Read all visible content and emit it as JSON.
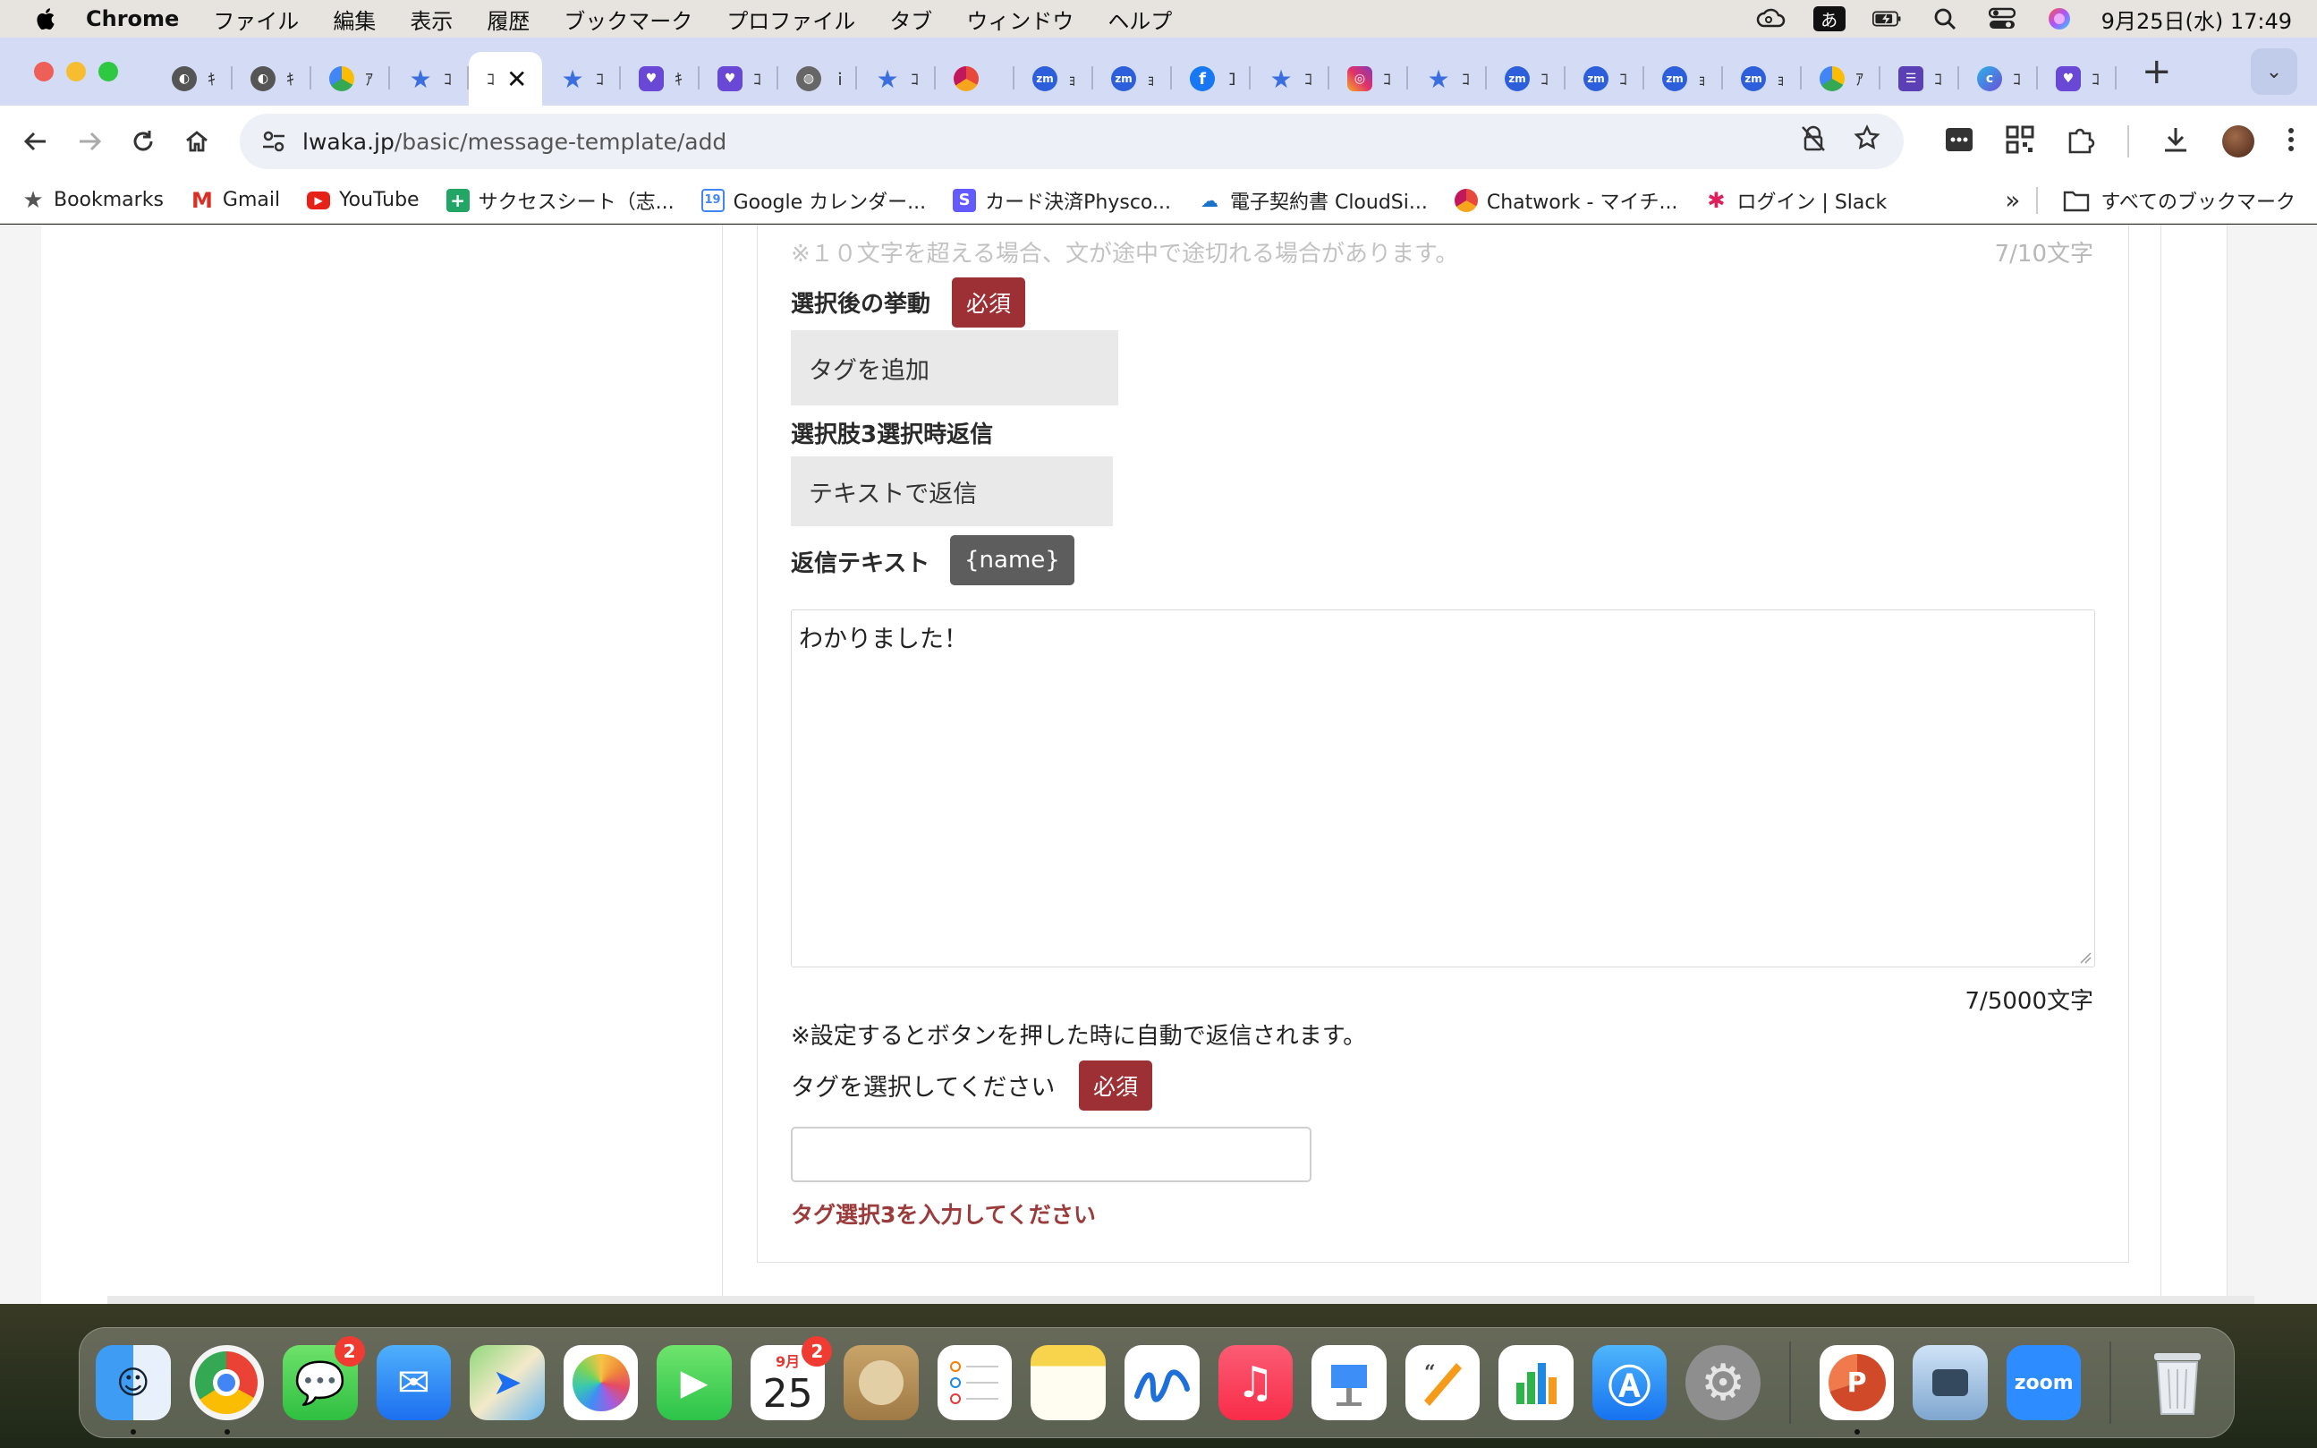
{
  "menubar": {
    "app_name": "Chrome",
    "items": [
      "ファイル",
      "編集",
      "表示",
      "履歴",
      "ブックマーク",
      "プロファイル",
      "タブ",
      "ウィンドウ",
      "ヘルプ"
    ],
    "ime": "あ",
    "clock": "9月25日(水)  17:49"
  },
  "tabs": {
    "active_title": "ｺ",
    "titles": [
      "ｷ",
      "ｷ",
      "ｱ",
      "ｺ",
      "ｺ",
      "ｷ",
      "ｺ",
      "ｉ",
      "ｺ",
      "（",
      "ｮ",
      "ｮ",
      "Ｉ",
      "ｺ",
      "ｺ",
      "ｺ",
      "ｺ",
      "ｺ",
      "ｮ",
      "ｮ",
      "ｱ",
      "ｺ",
      "ｺ",
      "ｺ"
    ]
  },
  "toolbar": {
    "url_domain": "lwaka.jp",
    "url_path": "/basic/message-template/add"
  },
  "bookmarks": {
    "items": [
      {
        "label": "Bookmarks",
        "icon": "star-icon"
      },
      {
        "label": "Gmail",
        "icon": "gmail-icon"
      },
      {
        "label": "YouTube",
        "icon": "youtube-icon"
      },
      {
        "label": "サクセスシート（志...",
        "icon": "sheets-icon"
      },
      {
        "label": "Google カレンダー...",
        "icon": "calendar-icon"
      },
      {
        "label": "カード決済Physco...",
        "icon": "stripe-icon"
      },
      {
        "label": "電子契約書 CloudSi...",
        "icon": "cloudsign-icon"
      },
      {
        "label": "Chatwork - マイチ...",
        "icon": "chatwork-icon"
      },
      {
        "label": "ログイン | Slack",
        "icon": "slack-icon"
      }
    ],
    "all_label": "すべてのブックマーク"
  },
  "form": {
    "note_top": "※１０文字を超える場合、文が途中で途切れる場合があります。",
    "count_top": "7/10文字",
    "action_label": "選択後の挙動",
    "required": "必須",
    "action_value": "タグを追加",
    "reply_label": "選択肢3選択時返信",
    "reply_value": "テキストで返信",
    "reply_text_label": "返信テキスト",
    "name_var": "{name}",
    "reply_text": "わかりました！",
    "count_bottom": "7/5000文字",
    "hint": "※設定するとボタンを押した時に自動で返信されます。",
    "tag_label": "タグを選択してください",
    "tag_value": "",
    "error": "タグ選択3を入力してください"
  },
  "dock": {
    "apps": [
      {
        "name": "finder",
        "badge": ""
      },
      {
        "name": "chrome",
        "badge": ""
      },
      {
        "name": "messages",
        "badge": "2"
      },
      {
        "name": "mail",
        "badge": ""
      },
      {
        "name": "maps",
        "badge": ""
      },
      {
        "name": "photos",
        "badge": ""
      },
      {
        "name": "facetime",
        "badge": ""
      },
      {
        "name": "calendar",
        "badge": "2",
        "month": "9月",
        "day": "25"
      },
      {
        "name": "contacts",
        "badge": ""
      },
      {
        "name": "reminders",
        "badge": ""
      },
      {
        "name": "notes",
        "badge": ""
      },
      {
        "name": "freeform",
        "badge": ""
      },
      {
        "name": "music",
        "badge": ""
      },
      {
        "name": "keynote",
        "badge": ""
      },
      {
        "name": "pages",
        "badge": ""
      },
      {
        "name": "numbers",
        "badge": ""
      },
      {
        "name": "app-store",
        "badge": ""
      },
      {
        "name": "system-settings",
        "badge": ""
      },
      {
        "name": "powerpoint",
        "badge": ""
      },
      {
        "name": "preview",
        "badge": ""
      },
      {
        "name": "zoom",
        "badge": "",
        "label": "zoom"
      },
      {
        "name": "trash",
        "badge": ""
      }
    ]
  },
  "colors": {
    "required_badge": "#9c3034",
    "var_badge": "#5d5d5d",
    "error_text": "#9c3b3b",
    "tabstrip": "#d3dcf4"
  }
}
